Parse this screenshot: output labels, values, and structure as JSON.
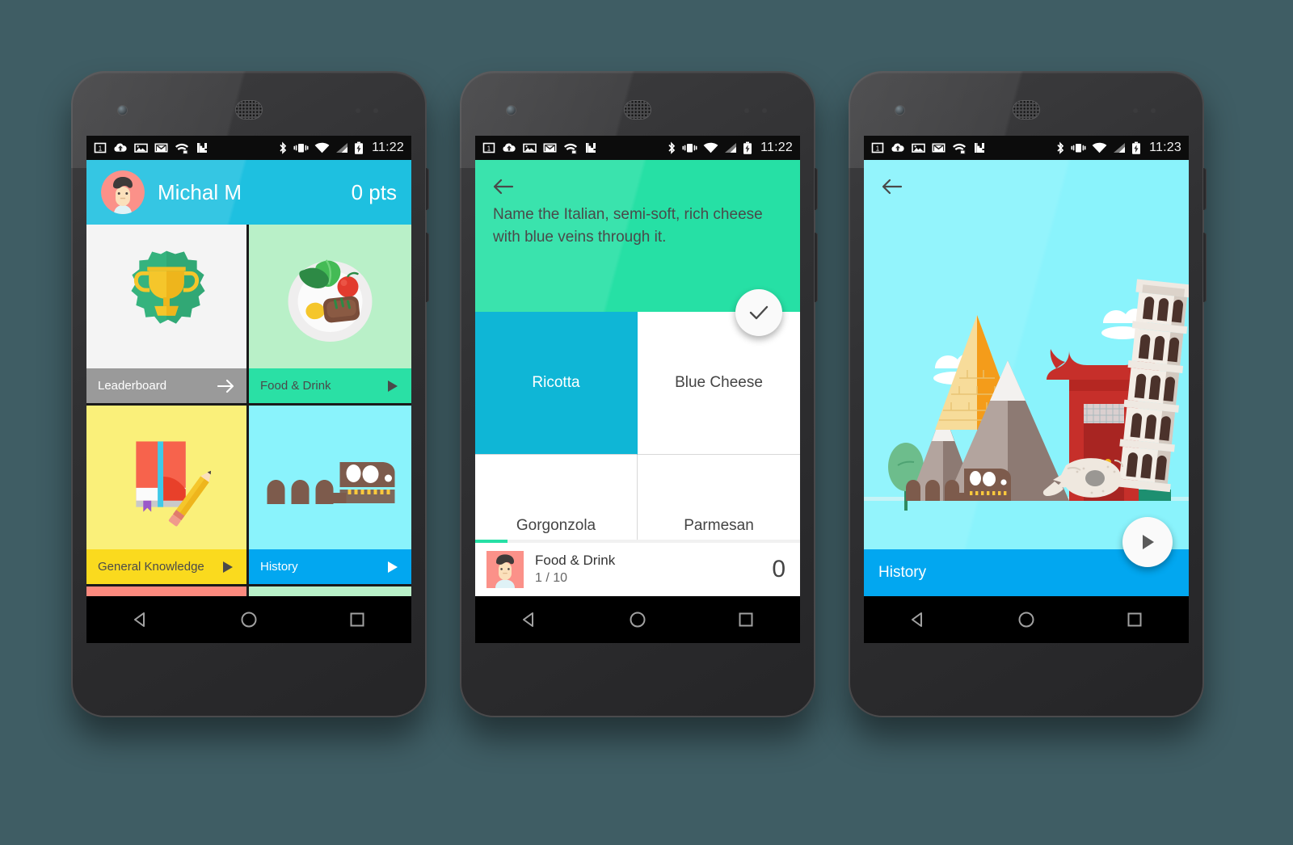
{
  "background_color": "#3f5d64",
  "phones": [
    {
      "id": "home",
      "status_bar": {
        "time": "11:22",
        "left_icons": [
          "sim-card-icon",
          "cloud-upload-icon",
          "photo-icon",
          "gmail-icon",
          "wifi-sync-icon",
          "app-icon"
        ],
        "right_icons": [
          "bluetooth-icon",
          "vibrate-icon",
          "wifi-icon",
          "signal-icon",
          "battery-charging-icon"
        ]
      },
      "header": {
        "avatar": "user-avatar",
        "username": "Michal M",
        "points": "0 pts"
      },
      "tiles": [
        {
          "label": "Leaderboard",
          "art": "trophy-badge",
          "art_bg": "#f4f4f4",
          "bar_bg": "#9a9a9a",
          "text_color": "#ffffff",
          "action_icon": "arrow-right-icon",
          "icon_color": "#ffffff"
        },
        {
          "label": "Food & Drink",
          "art": "plate-of-food",
          "art_bg": "#b9f0c8",
          "bar_bg": "#2ae0a5",
          "text_color": "#4a4a4a",
          "action_icon": "play-icon",
          "icon_color": "#4a4a4a"
        },
        {
          "label": "General Knowledge",
          "art": "book-and-pencil",
          "art_bg": "#faf07a",
          "bar_bg": "#fada1e",
          "text_color": "#4a4a4a",
          "action_icon": "play-icon",
          "icon_color": "#4a4a4a"
        },
        {
          "label": "History",
          "art": "dinosaur-skeleton",
          "art_bg": "#8af3fc",
          "bar_bg": "#02a7f0",
          "text_color": "#ffffff",
          "action_icon": "play-icon",
          "icon_color": "#ffffff"
        }
      ],
      "tile_stubs": [
        {
          "bar_bg": "#fc8a7e"
        },
        {
          "bar_bg": "#b9f0c8"
        }
      ],
      "nav_bar": [
        "back-triangle-icon",
        "home-circle-icon",
        "recents-square-icon"
      ]
    },
    {
      "id": "question",
      "status_bar": {
        "time": "11:22",
        "left_icons": [
          "sim-card-icon",
          "cloud-upload-icon",
          "photo-icon",
          "gmail-icon",
          "wifi-sync-icon",
          "app-icon"
        ],
        "right_icons": [
          "bluetooth-icon",
          "vibrate-icon",
          "wifi-icon",
          "signal-icon",
          "battery-charging-icon"
        ]
      },
      "header": {
        "back_icon": "back-arrow-icon",
        "background": "#26e0a5",
        "question": "Name the Italian, semi-soft, rich cheese with blue veins through it."
      },
      "fab": {
        "icon": "check-icon",
        "name": "confirm-answer-fab"
      },
      "answers": [
        {
          "label": "Ricotta",
          "selected": true
        },
        {
          "label": "Blue Cheese",
          "selected": false
        },
        {
          "label": "Gorgonzola",
          "selected": false
        },
        {
          "label": "Parmesan",
          "selected": false
        }
      ],
      "footer": {
        "avatar": "user-avatar",
        "category": "Food & Drink",
        "progress_label": "1 / 10",
        "progress_percent": 10,
        "score": "0"
      },
      "nav_bar": [
        "back-triangle-icon",
        "home-circle-icon",
        "recents-square-icon"
      ]
    },
    {
      "id": "category",
      "status_bar": {
        "time": "11:23",
        "left_icons": [
          "sim-card-icon",
          "cloud-upload-icon",
          "photo-icon",
          "gmail-icon",
          "wifi-sync-icon",
          "app-icon"
        ],
        "right_icons": [
          "bluetooth-icon",
          "vibrate-icon",
          "wifi-icon",
          "signal-icon",
          "battery-charging-icon"
        ]
      },
      "back_icon": "back-arrow-icon",
      "background": "#8af3fc",
      "illustration": "history-landmarks",
      "title": "History",
      "title_bar_color": "#02a7f0",
      "fab": {
        "icon": "play-icon",
        "name": "start-quiz-fab"
      },
      "nav_bar": [
        "back-triangle-icon",
        "home-circle-icon",
        "recents-square-icon"
      ]
    }
  ]
}
